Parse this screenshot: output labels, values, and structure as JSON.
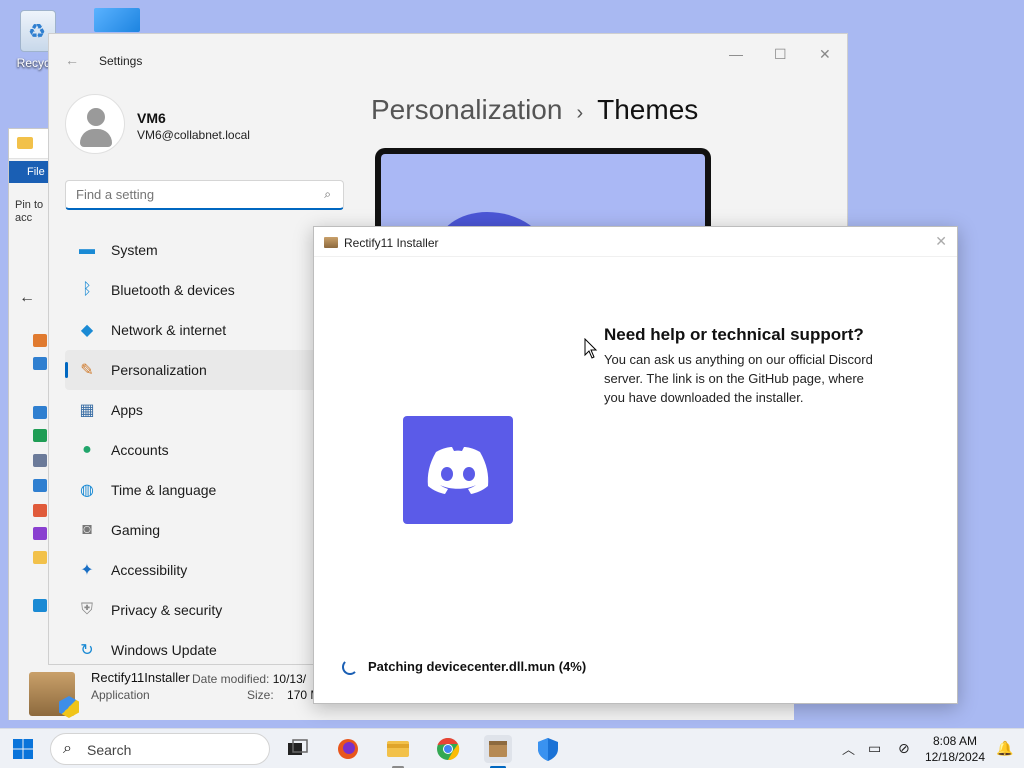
{
  "desktop": {
    "recycle_label": "Recycle"
  },
  "explorer": {
    "file_menu": "File",
    "pin_label": "Pin to\nacc",
    "selected_file": {
      "name": "Rectify11Installer",
      "type": "Application",
      "date_label": "Date modified:",
      "date_value": "10/13/",
      "size_label": "Size:",
      "size_value": "170 M"
    }
  },
  "settings": {
    "app_title": "Settings",
    "user": {
      "name": "VM6",
      "email": "VM6@collabnet.local"
    },
    "search_placeholder": "Find a setting",
    "nav": [
      {
        "label": "System",
        "icon": "monitor-icon",
        "color": "#1a8ad4"
      },
      {
        "label": "Bluetooth & devices",
        "icon": "bluetooth-icon",
        "color": "#1a8ad4"
      },
      {
        "label": "Network & internet",
        "icon": "wifi-icon",
        "color": "#1a8ad4"
      },
      {
        "label": "Personalization",
        "icon": "brush-icon",
        "color": "#d07a2a"
      },
      {
        "label": "Apps",
        "icon": "apps-icon",
        "color": "#3a6ea5"
      },
      {
        "label": "Accounts",
        "icon": "person-icon",
        "color": "#21a56b"
      },
      {
        "label": "Time & language",
        "icon": "globe-icon",
        "color": "#1a8ad4"
      },
      {
        "label": "Gaming",
        "icon": "gamepad-icon",
        "color": "#777777"
      },
      {
        "label": "Accessibility",
        "icon": "accessibility-icon",
        "color": "#1a6fc4"
      },
      {
        "label": "Privacy & security",
        "icon": "shield-icon",
        "color": "#888888"
      },
      {
        "label": "Windows Update",
        "icon": "update-icon",
        "color": "#1a8ad4"
      }
    ],
    "active_nav": "Personalization",
    "breadcrumb": {
      "parent": "Personalization",
      "separator": "›",
      "current": "Themes"
    }
  },
  "installer": {
    "title": "Rectify11 Installer",
    "help_title": "Need help or technical support?",
    "help_text": "You can ask us anything on our official Discord server. The link is on the GitHub page, where you have downloaded the installer.",
    "status": "Patching devicecenter.dll.mun (4%)",
    "progress_percent": 4
  },
  "taskbar": {
    "search_label": "Search",
    "apps": [
      "task-view-icon",
      "firefox-icon",
      "file-explorer-icon",
      "chrome-icon",
      "rectify-installer-icon",
      "windows-security-icon"
    ],
    "clock_time": "8:08 AM",
    "clock_date": "12/18/2024"
  },
  "colors": {
    "desktop_bg": "#a9b9f2",
    "accent": "#0067c0",
    "discord": "#5b5be8"
  }
}
